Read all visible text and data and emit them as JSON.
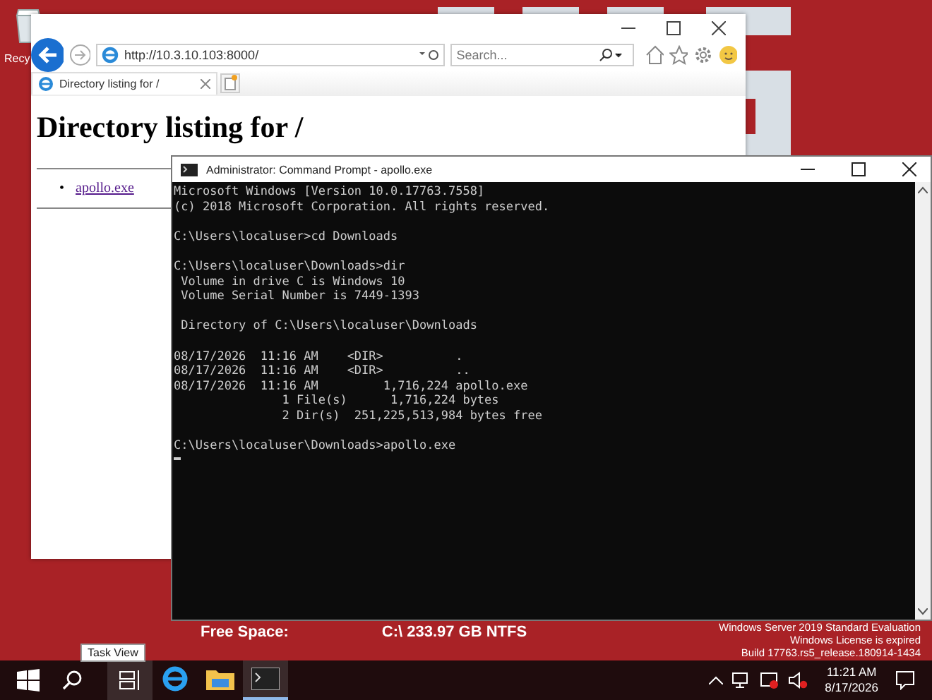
{
  "desktop": {
    "icon_label": "Recy",
    "info_label": "Free Space:",
    "info_value": "C:\\ 233.97 GB NTFS",
    "watermark": [
      "Windows Server 2019 Standard Evaluation",
      "Windows License is expired",
      "Build 17763.rs5_release.180914-1434"
    ]
  },
  "browser": {
    "address": "http://10.3.10.103:8000/",
    "search": {
      "placeholder": "Search..."
    },
    "tabs": [
      {
        "label": "Directory listing for /",
        "selected": true
      }
    ],
    "heading": "Directory listing for /",
    "links": [
      {
        "bullet": "•",
        "label": "apollo.exe"
      }
    ]
  },
  "console": {
    "title": "Administrator: Command Prompt - apollo.exe",
    "blocks": [
      [
        "Microsoft Windows [Version 10.0.17763.7558]",
        "(c) 2018 Microsoft Corporation. All rights reserved."
      ],
      [
        "C:\\Users\\localuser>cd Downloads"
      ],
      [
        "C:\\Users\\localuser\\Downloads>dir",
        " Volume in drive C is Windows 10",
        " Volume Serial Number is 7449-1393"
      ],
      [
        " Directory of C:\\Users\\localuser\\Downloads"
      ],
      [
        "08/17/2026  11:16 AM    <DIR>          .",
        "08/17/2026  11:16 AM    <DIR>          ..",
        "08/17/2026  11:16 AM         1,716,224 apollo.exe",
        "               1 File(s)      1,716,224 bytes",
        "               2 Dir(s)  251,225,513,984 bytes free"
      ],
      [
        "C:\\Users\\localuser\\Downloads>apollo.exe"
      ]
    ]
  },
  "taskbar": {
    "tooltip": "Task View",
    "apps": [
      {
        "kind": "ie",
        "active": false
      },
      {
        "kind": "explorer",
        "active": false
      },
      {
        "kind": "cmd",
        "active": true
      }
    ],
    "time": "11:21 AM",
    "date": "8/17/2026"
  }
}
